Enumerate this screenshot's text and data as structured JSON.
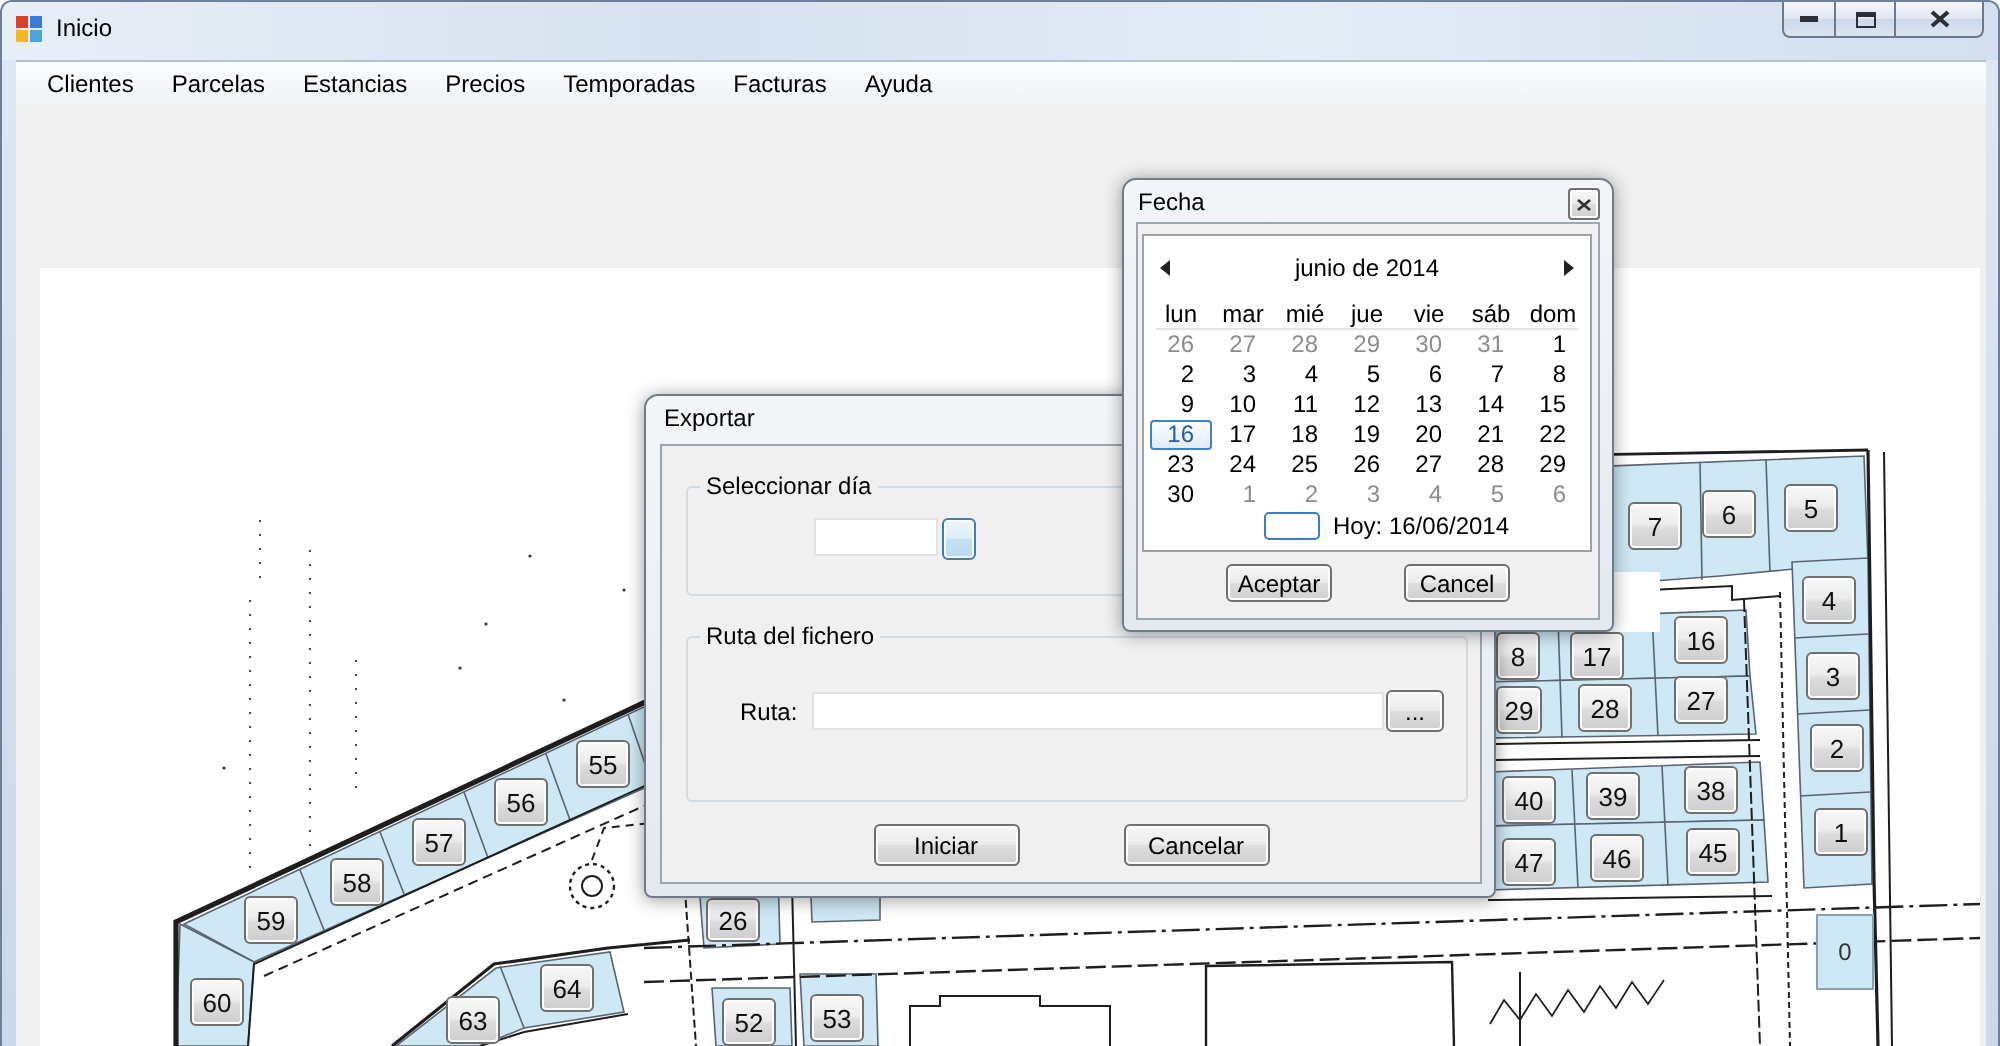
{
  "window": {
    "title": "Inicio"
  },
  "menu": [
    {
      "label": "Clientes"
    },
    {
      "label": "Parcelas"
    },
    {
      "label": "Estancias"
    },
    {
      "label": "Precios"
    },
    {
      "label": "Temporadas"
    },
    {
      "label": "Facturas"
    },
    {
      "label": "Ayuda"
    }
  ],
  "map": {
    "parcels": [
      {
        "label": "7",
        "kind": "button"
      },
      {
        "label": "6",
        "kind": "button"
      },
      {
        "label": "5",
        "kind": "button"
      },
      {
        "label": "4",
        "kind": "button"
      },
      {
        "label": "8",
        "kind": "button"
      },
      {
        "label": "17",
        "kind": "button"
      },
      {
        "label": "16",
        "kind": "button"
      },
      {
        "label": "3",
        "kind": "button"
      },
      {
        "label": "29",
        "kind": "button"
      },
      {
        "label": "28",
        "kind": "button"
      },
      {
        "label": "27",
        "kind": "button"
      },
      {
        "label": "55",
        "kind": "button"
      },
      {
        "label": "2",
        "kind": "button"
      },
      {
        "label": "56",
        "kind": "button"
      },
      {
        "label": "40",
        "kind": "button"
      },
      {
        "label": "39",
        "kind": "button"
      },
      {
        "label": "38",
        "kind": "button"
      },
      {
        "label": "57",
        "kind": "button"
      },
      {
        "label": "58",
        "kind": "button"
      },
      {
        "label": "47",
        "kind": "button"
      },
      {
        "label": "46",
        "kind": "button"
      },
      {
        "label": "45",
        "kind": "button"
      },
      {
        "label": "1",
        "kind": "button"
      },
      {
        "label": "59",
        "kind": "button"
      },
      {
        "label": "26",
        "kind": "button"
      },
      {
        "label": "60",
        "kind": "button"
      },
      {
        "label": "64",
        "kind": "button"
      },
      {
        "label": "0",
        "kind": "plain"
      },
      {
        "label": "63",
        "kind": "button"
      },
      {
        "label": "52",
        "kind": "button"
      },
      {
        "label": "53",
        "kind": "button"
      }
    ]
  },
  "export_dialog": {
    "title": "Exportar",
    "date_group": {
      "title": "Seleccionar día",
      "date_button": {
        "focused": true
      }
    },
    "path_group": {
      "title": "Ruta del fichero",
      "label": "Ruta:",
      "browse_button": "..."
    },
    "buttons": [
      {
        "label": "Iniciar"
      },
      {
        "label": "Cancelar"
      }
    ]
  },
  "date_dialog": {
    "title": "Fecha",
    "calendar": {
      "month": "junio de 2014",
      "weekdays": [
        "lun",
        "mar",
        "mié",
        "jue",
        "vie",
        "sáb",
        "dom"
      ],
      "weeks": [
        {
          "days": [
            {
              "day": "26",
              "outside": true,
              "selected": false
            },
            {
              "day": "27",
              "outside": true,
              "selected": false
            },
            {
              "day": "28",
              "outside": true,
              "selected": false
            },
            {
              "day": "29",
              "outside": true,
              "selected": false
            },
            {
              "day": "30",
              "outside": true,
              "selected": false
            },
            {
              "day": "31",
              "outside": true,
              "selected": false
            },
            {
              "day": "1",
              "outside": false,
              "selected": false
            }
          ]
        },
        {
          "days": [
            {
              "day": "2",
              "outside": false,
              "selected": false
            },
            {
              "day": "3",
              "outside": false,
              "selected": false
            },
            {
              "day": "4",
              "outside": false,
              "selected": false
            },
            {
              "day": "5",
              "outside": false,
              "selected": false
            },
            {
              "day": "6",
              "outside": false,
              "selected": false
            },
            {
              "day": "7",
              "outside": false,
              "selected": false
            },
            {
              "day": "8",
              "outside": false,
              "selected": false
            }
          ]
        },
        {
          "days": [
            {
              "day": "9",
              "outside": false,
              "selected": false
            },
            {
              "day": "10",
              "outside": false,
              "selected": false
            },
            {
              "day": "11",
              "outside": false,
              "selected": false
            },
            {
              "day": "12",
              "outside": false,
              "selected": false
            },
            {
              "day": "13",
              "outside": false,
              "selected": false
            },
            {
              "day": "14",
              "outside": false,
              "selected": false
            },
            {
              "day": "15",
              "outside": false,
              "selected": false
            }
          ]
        },
        {
          "days": [
            {
              "day": "16",
              "outside": false,
              "selected": true
            },
            {
              "day": "17",
              "outside": false,
              "selected": false
            },
            {
              "day": "18",
              "outside": false,
              "selected": false
            },
            {
              "day": "19",
              "outside": false,
              "selected": false
            },
            {
              "day": "20",
              "outside": false,
              "selected": false
            },
            {
              "day": "21",
              "outside": false,
              "selected": false
            },
            {
              "day": "22",
              "outside": false,
              "selected": false
            }
          ]
        },
        {
          "days": [
            {
              "day": "23",
              "outside": false,
              "selected": false
            },
            {
              "day": "24",
              "outside": false,
              "selected": false
            },
            {
              "day": "25",
              "outside": false,
              "selected": false
            },
            {
              "day": "26",
              "outside": false,
              "selected": false
            },
            {
              "day": "27",
              "outside": false,
              "selected": false
            },
            {
              "day": "28",
              "outside": false,
              "selected": false
            },
            {
              "day": "29",
              "outside": false,
              "selected": false
            }
          ]
        },
        {
          "days": [
            {
              "day": "30",
              "outside": false,
              "selected": false
            },
            {
              "day": "1",
              "outside": true,
              "selected": false
            },
            {
              "day": "2",
              "outside": true,
              "selected": false
            },
            {
              "day": "3",
              "outside": true,
              "selected": false
            },
            {
              "day": "4",
              "outside": true,
              "selected": false
            },
            {
              "day": "5",
              "outside": true,
              "selected": false
            },
            {
              "day": "6",
              "outside": true,
              "selected": false
            }
          ]
        }
      ],
      "today": "Hoy: 16/06/2014"
    },
    "buttons": [
      {
        "label": "Aceptar"
      },
      {
        "label": "Cancel"
      }
    ]
  }
}
